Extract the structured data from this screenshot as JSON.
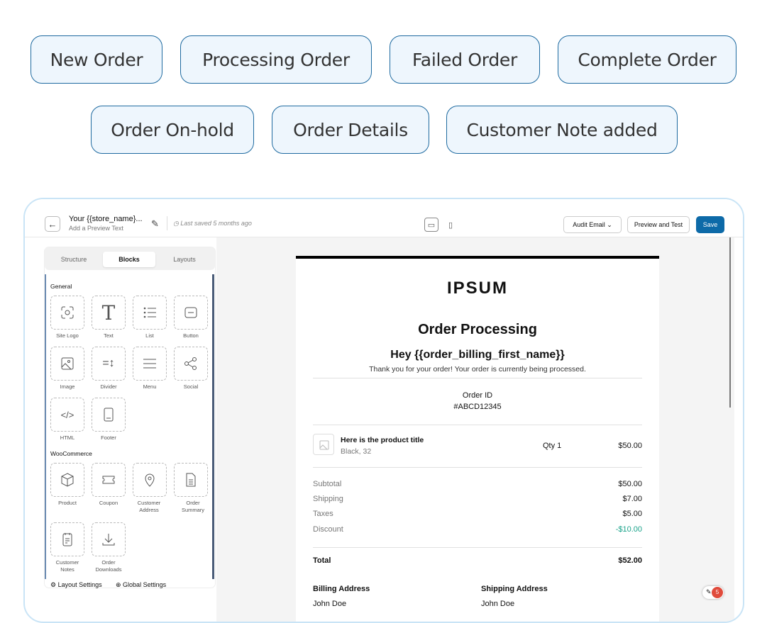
{
  "pills": [
    "New Order",
    "Processing Order",
    "Failed Order",
    "Complete Order",
    "Order On-hold",
    "Order Details",
    "Customer Note added"
  ],
  "topbar": {
    "title": "Your {{store_name}...",
    "subtitle": "Add a Preview Text",
    "saved": "Last saved 5 months ago",
    "audit": "Audit Email",
    "preview": "Preview and Test",
    "save": "Save"
  },
  "panel": {
    "tabs": [
      "Structure",
      "Blocks",
      "Layouts"
    ],
    "general_title": "General",
    "general_blocks": [
      "Site Logo",
      "Text",
      "List",
      "Button",
      "Image",
      "Divider",
      "Menu",
      "Social",
      "HTML",
      "Footer"
    ],
    "woo_title": "WooCommerce",
    "woo_blocks": [
      "Product",
      "Coupon",
      "Customer Address",
      "Order Summary",
      "Customer Notes",
      "Order Downloads"
    ],
    "layout_settings": "Layout Settings",
    "global_settings": "Global Settings"
  },
  "email": {
    "logo": "IPSUM",
    "heading": "Order Processing",
    "greeting": "Hey {{order_billing_first_name}}",
    "intro": "Thank you for your order! Your order is currently being processed.",
    "order_id_label": "Order ID",
    "order_id": "#ABCD12345",
    "product_title": "Here is the product title",
    "product_variant": "Black, 32",
    "qty": "Qty 1",
    "price": "$50.00",
    "totals": [
      {
        "label": "Subtotal",
        "value": "$50.00"
      },
      {
        "label": "Shipping",
        "value": "$7.00"
      },
      {
        "label": "Taxes",
        "value": "$5.00"
      },
      {
        "label": "Discount",
        "value": "-$10.00"
      }
    ],
    "total_label": "Total",
    "total_value": "$52.00",
    "billing_title": "Billing Address",
    "billing_name": "John Doe",
    "shipping_title": "Shipping Address",
    "shipping_name": "John Doe"
  },
  "badge_count": "5",
  "colors": {
    "accent": "#0d6aa8",
    "discount": "#1aa38a",
    "pill_border": "#1e6aa0",
    "pill_bg": "#eef6fd"
  }
}
